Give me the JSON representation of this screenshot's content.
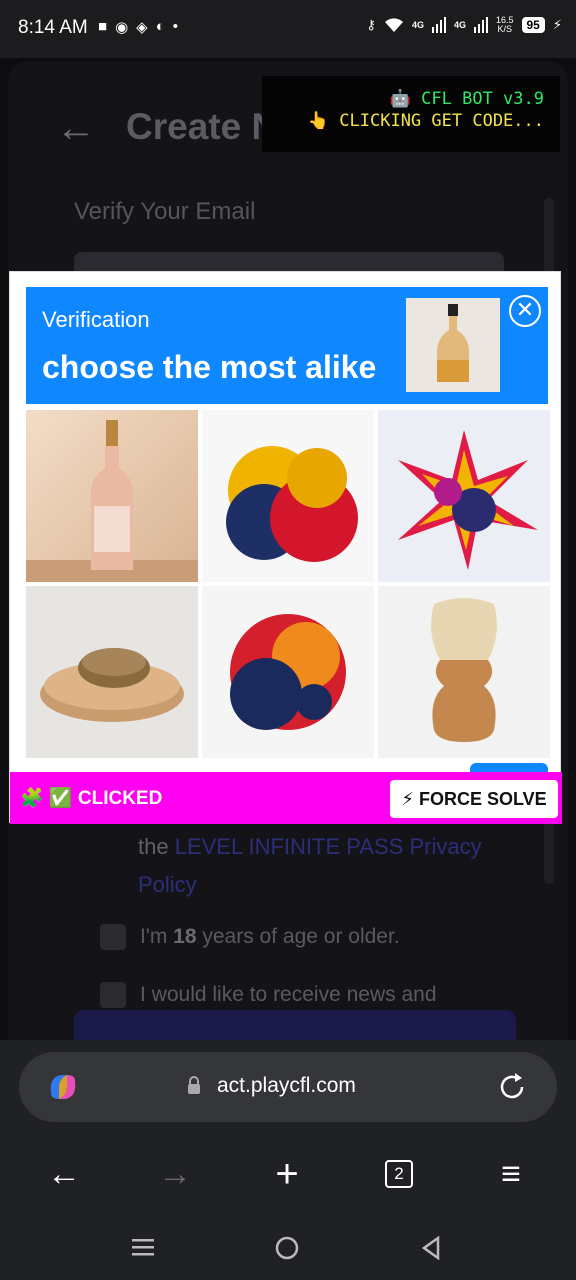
{
  "status_bar": {
    "time": "8:14 AM",
    "net1": "4G",
    "net2": "4G",
    "speed_top": "16.5",
    "speed_bottom": "K/S",
    "battery": "95"
  },
  "page": {
    "title": "Create New",
    "verify_label": "Verify Your Email",
    "privacy_prefix": "the ",
    "privacy_link": "LEVEL INFINITE PASS Privacy Policy",
    "age_prefix": "I'm ",
    "age_bold": "18",
    "age_suffix": " years of age or older.",
    "news_label": "I would like to receive news and"
  },
  "bot": {
    "title": "🤖 CFL BOT v3.9",
    "status": "👆 CLICKING GET CODE..."
  },
  "captcha": {
    "heading_small": "Verification",
    "heading_big": "choose the most alike",
    "reference_image": "bottle-icon",
    "tiles": [
      "bottle",
      "powder",
      "powder",
      "brush",
      "powder",
      "shaving-brush"
    ]
  },
  "bot_bar": {
    "clicked_label": "🧩 ✅ CLICKED",
    "force_label": "⚡ FORCE SOLVE"
  },
  "browser": {
    "url": "act.playcfl.com",
    "tab_count": "2"
  }
}
